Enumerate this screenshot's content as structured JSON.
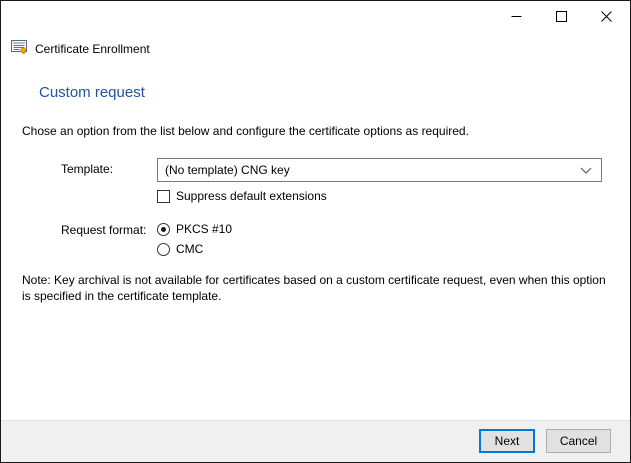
{
  "window": {
    "app_title": "Certificate Enrollment"
  },
  "titlebar": {
    "icons": {
      "minimize": "minimize-dash",
      "maximize": "maximize-square",
      "close": "close-x"
    }
  },
  "main": {
    "page_title": "Custom request",
    "instruction": "Chose an option from the list below and configure the certificate options as required.",
    "template_field": {
      "label": "Template:",
      "selected_option": "(No template) CNG key",
      "suppress_extensions": {
        "label": "Suppress default extensions",
        "checked": false
      }
    },
    "request_format": {
      "label": "Request format:",
      "options": [
        {
          "label": "PKCS #10",
          "selected": true
        },
        {
          "label": "CMC",
          "selected": false
        }
      ]
    },
    "note": "Note: Key archival is not available for certificates based on a custom certificate request, even when this option is specified in the certificate template."
  },
  "footer": {
    "next_label": "Next",
    "cancel_label": "Cancel"
  },
  "colors": {
    "heading_blue": "#2353a4",
    "focus_blue": "#0078d7",
    "footer_bg": "#f0f0f0",
    "window_bg": "#ffffff"
  }
}
